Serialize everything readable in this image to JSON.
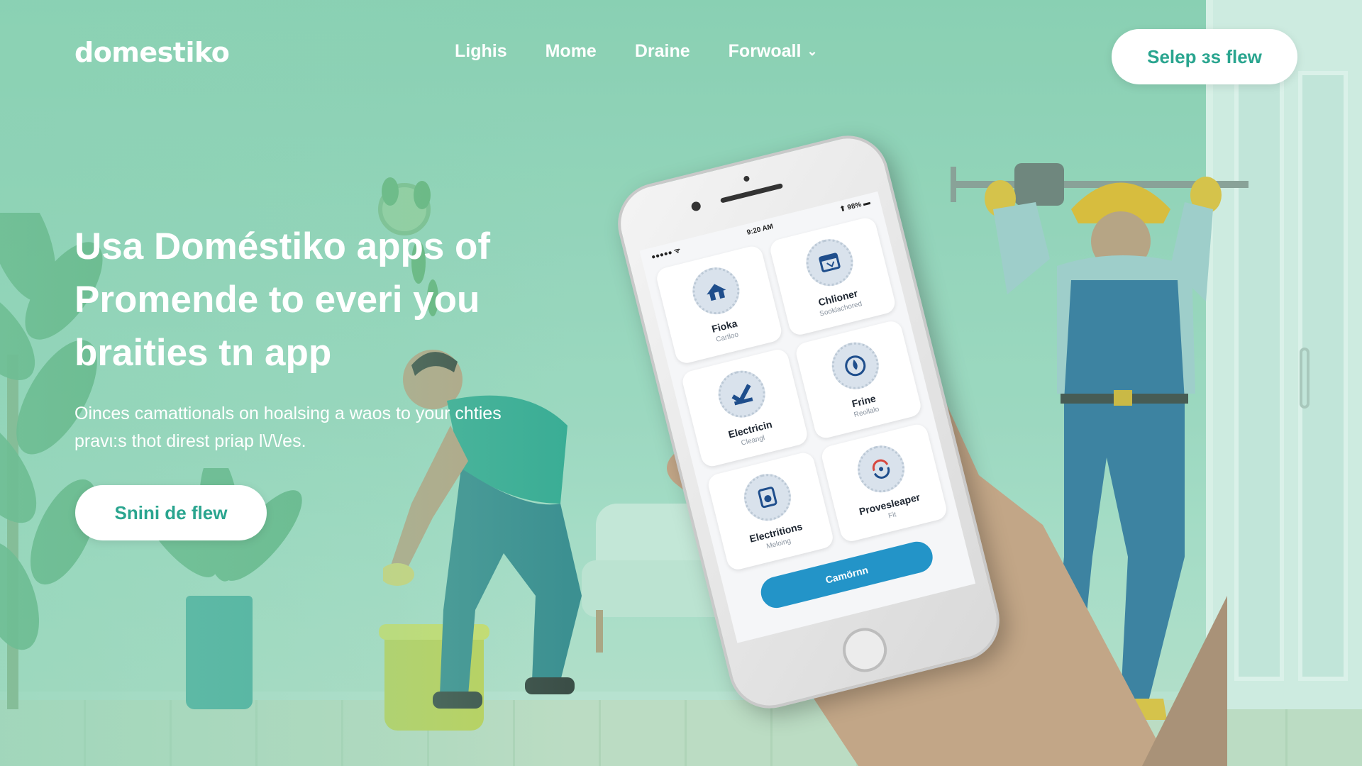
{
  "brand": {
    "logo_text": "domestiko"
  },
  "nav": {
    "items": [
      {
        "label": "Lighis"
      },
      {
        "label": "Mome"
      },
      {
        "label": "Draine"
      },
      {
        "label": "Forwoall",
        "has_dropdown": true
      }
    ]
  },
  "header": {
    "cta_label": "Selep ɜs flew"
  },
  "hero": {
    "title": "Usa Doméstiko apps of Promende to everi you braities tn app",
    "subtitle": "Oinces camattionals on hoalsing a waos to your chties pravι:s thot direst priap l\\/\\/es.",
    "cta_label": "Snini de flew"
  },
  "phone": {
    "status": {
      "carrier": "●●●●● ᯤ",
      "time": "9:20 AM",
      "battery": "⬆ 98% ▬"
    },
    "tiles": [
      {
        "title": "Fioka",
        "subtitle": "Cartloo",
        "icon": "house-icon"
      },
      {
        "title": "Chlioner",
        "subtitle": "Sooklachored",
        "icon": "window-icon"
      },
      {
        "title": "Electricin",
        "subtitle": "Cleangl",
        "icon": "checkmark-icon"
      },
      {
        "title": "Frine",
        "subtitle": "Reollalo",
        "icon": "drop-icon"
      },
      {
        "title": "Electritions",
        "subtitle": "Meloing",
        "icon": "appliance-icon"
      },
      {
        "title": "Provesleaper",
        "subtitle": "Fit",
        "icon": "refresh-icon"
      }
    ],
    "cta_label": "Camörnn"
  },
  "colors": {
    "accent": "#2aa58f",
    "screen_button": "#2394c8",
    "background": "#9dd6bf"
  }
}
